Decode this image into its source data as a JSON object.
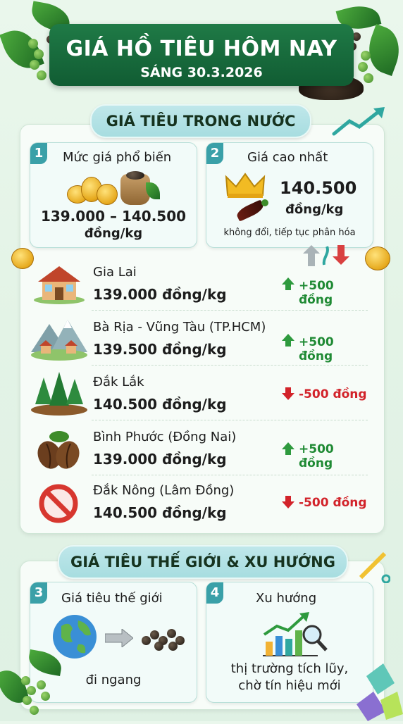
{
  "header": {
    "title": "GIÁ HỒ TIÊU HÔM NAY",
    "subtitle": "SÁNG 30.3.2026"
  },
  "domestic": {
    "section_title": "GIÁ TIÊU TRONG NƯỚC",
    "card1": {
      "number": "1",
      "title": "Mức giá phổ biến",
      "range": "139.000 – 140.500",
      "unit": "đồng/kg"
    },
    "card2": {
      "number": "2",
      "title": "Giá cao nhất",
      "price": "140.500",
      "unit": "đồng/kg",
      "note": "không đổi, tiếp tục phân hóa"
    },
    "regions": [
      {
        "name": "Gia Lai",
        "price": "139.000 đồng/kg",
        "change": "+500 đồng",
        "direction": "up",
        "icon": "house-icon"
      },
      {
        "name": "Bà Rịa - Vũng Tàu (TP.HCM)",
        "price": "139.500 đồng/kg",
        "change": "+500 đồng",
        "direction": "up",
        "icon": "mountain-village-icon"
      },
      {
        "name": "Đắk Lắk",
        "price": "140.500 đồng/kg",
        "change": "-500 đồng",
        "direction": "down",
        "icon": "pine-trees-icon"
      },
      {
        "name": "Bình Phước (Đồng Nai)",
        "price": "139.000 đồng/kg",
        "change": "+500 đồng",
        "direction": "up",
        "icon": "coffee-beans-icon"
      },
      {
        "name": "Đắk Nông (Lâm Đồng)",
        "price": "140.500 đồng/kg",
        "change": "-500 đồng",
        "direction": "down",
        "icon": "prohibited-icon"
      }
    ]
  },
  "world": {
    "section_title": "GIÁ TIÊU THẾ GIỚI & XU HƯỚNG",
    "card3": {
      "number": "3",
      "title": "Giá tiêu thế giới",
      "status": "đi ngang"
    },
    "card4": {
      "number": "4",
      "title": "Xu hướng",
      "line1": "thị trường tích lũy,",
      "line2": "chờ tín hiệu mới"
    }
  },
  "colors": {
    "header_green": "#1f7a46",
    "up_green": "#1f8a34",
    "down_red": "#d2232a",
    "badge_teal": "#3aa0a8"
  }
}
